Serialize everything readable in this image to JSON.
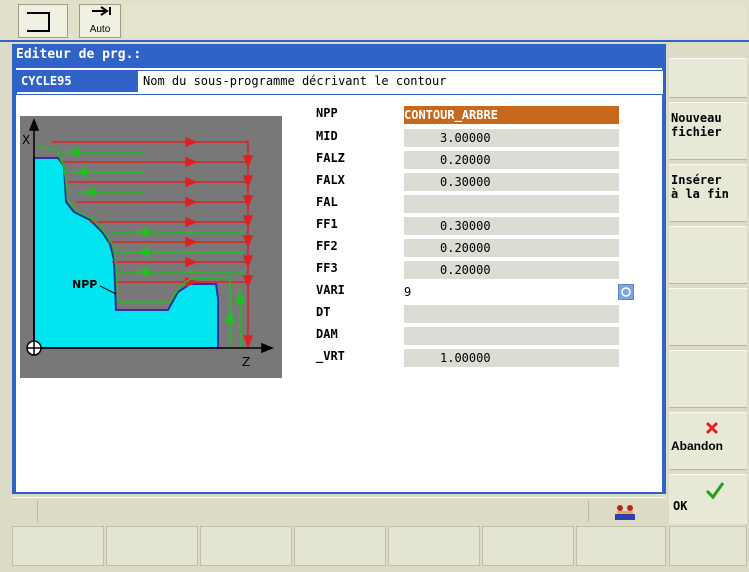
{
  "topbar": {
    "mode_label": "Auto"
  },
  "editor": {
    "title": "Editeur de prg.:",
    "cycle_name": "CYCLE95",
    "cycle_description": "Nom du sous-programme décrivant le contour"
  },
  "diagram": {
    "npp_label": "NPP",
    "x_axis": "X",
    "z_axis": "Z"
  },
  "params": [
    {
      "label": "NPP",
      "value": "CONTOUR_ARBRE"
    },
    {
      "label": "MID",
      "value": "3.00000"
    },
    {
      "label": "FALZ",
      "value": "0.20000"
    },
    {
      "label": "FALX",
      "value": "0.30000"
    },
    {
      "label": "FAL",
      "value": ""
    },
    {
      "label": "FF1",
      "value": "0.30000"
    },
    {
      "label": "FF2",
      "value": "0.20000"
    },
    {
      "label": "FF3",
      "value": "0.20000"
    },
    {
      "label": "VARI",
      "value": "9"
    },
    {
      "label": "DT",
      "value": ""
    },
    {
      "label": "DAM",
      "value": ""
    },
    {
      "label": "_VRT",
      "value": "1.00000"
    }
  ],
  "softkeys": {
    "new_file_1": "Nouveau",
    "new_file_2": "fichier",
    "insert_1": "Insérer",
    "insert_2": "à la fin",
    "cancel": "Abandon",
    "ok": "OK"
  },
  "colors": {
    "accent": "#2f63c8",
    "selected": "#c8681c",
    "part": "#00e5f0",
    "cut_red": "#e02020",
    "cut_green": "#20c020"
  }
}
